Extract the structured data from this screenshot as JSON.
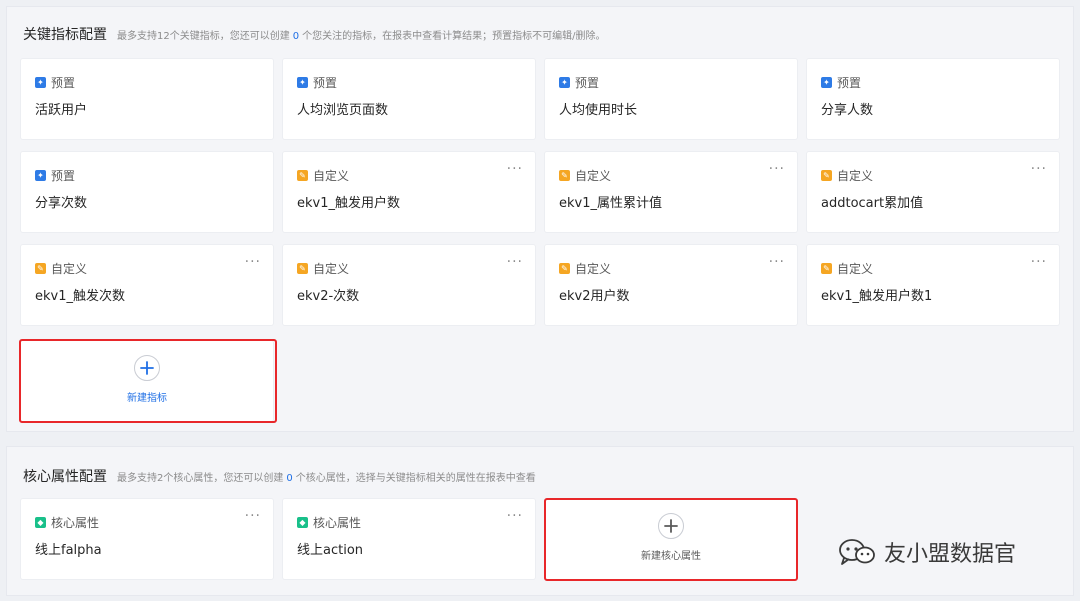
{
  "metrics_section": {
    "title": "关键指标配置",
    "desc_before": "最多支持12个关键指标，您还可以创建",
    "remaining": "0",
    "desc_after": "个您关注的指标，在报表中查看计算结果；预置指标不可编辑/删除。",
    "cards": [
      {
        "type": "预置",
        "name": "活跃用户",
        "kind": "preset"
      },
      {
        "type": "预置",
        "name": "人均浏览页面数",
        "kind": "preset"
      },
      {
        "type": "预置",
        "name": "人均使用时长",
        "kind": "preset"
      },
      {
        "type": "预置",
        "name": "分享人数",
        "kind": "preset"
      },
      {
        "type": "预置",
        "name": "分享次数",
        "kind": "preset"
      },
      {
        "type": "自定义",
        "name": "ekv1_触发用户数",
        "kind": "custom"
      },
      {
        "type": "自定义",
        "name": "ekv1_属性累计值",
        "kind": "custom"
      },
      {
        "type": "自定义",
        "name": "addtocart累加值",
        "kind": "custom"
      },
      {
        "type": "自定义",
        "name": "ekv1_触发次数",
        "kind": "custom"
      },
      {
        "type": "自定义",
        "name": "ekv2-次数",
        "kind": "custom"
      },
      {
        "type": "自定义",
        "name": "ekv2用户数",
        "kind": "custom"
      },
      {
        "type": "自定义",
        "name": "ekv1_触发用户数1",
        "kind": "custom"
      }
    ],
    "add_label": "新建指标"
  },
  "attrs_section": {
    "title": "核心属性配置",
    "desc_before": "最多支持2个核心属性，您还可以创建",
    "remaining": "0",
    "desc_after": "个核心属性，选择与关键指标相关的属性在报表中查看",
    "cards": [
      {
        "type": "核心属性",
        "name": "线上falpha"
      },
      {
        "type": "核心属性",
        "name": "线上action"
      }
    ],
    "add_label": "新建核心属性"
  },
  "more_glyph": "···",
  "watermark": "友小盟数据官",
  "colors": {
    "preset_icon": "#2e7be6",
    "custom_icon": "#f5a623",
    "core_icon": "#19c08a",
    "highlight": "#e8272a",
    "accent_number": "#1f6fe5"
  }
}
